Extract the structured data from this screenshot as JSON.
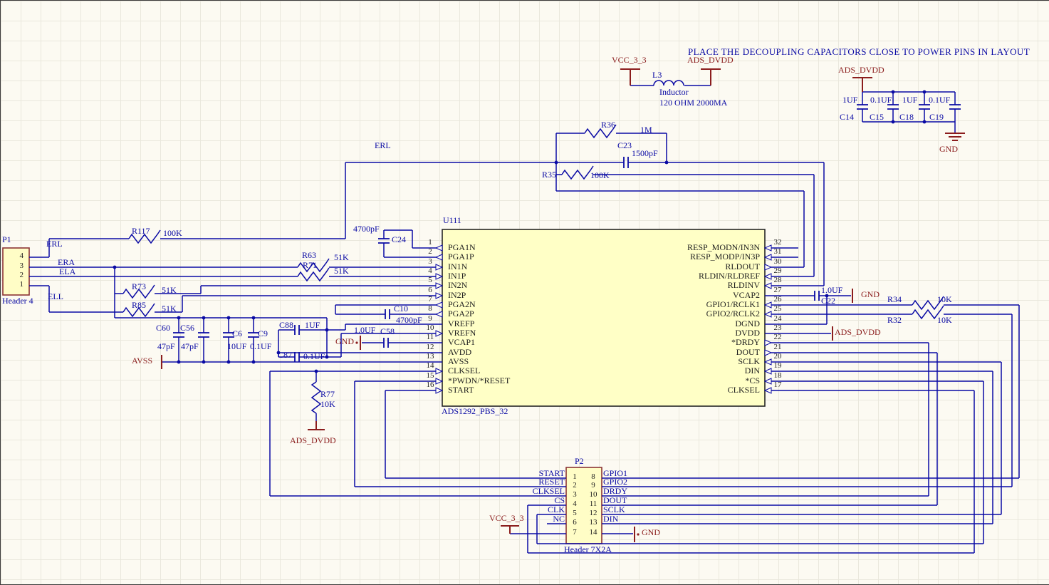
{
  "note": "PLACE THE DECOUPLING CAPACITORS CLOSE TO POWER PINS IN LAYOUT",
  "power": {
    "vcc": "VCC_3_3",
    "ads_dvdd": "ADS_DVDD",
    "gnd": "GND",
    "avss": "AVSS"
  },
  "nets": {
    "erl": "ERL",
    "era": "ERA",
    "ela": "ELA",
    "ell": "ELL"
  },
  "inductor": {
    "ref": "L3",
    "desc": "Inductor",
    "value": "120 OHM 2000MA"
  },
  "decoupling": {
    "caps": [
      {
        "ref": "C14",
        "value": "1UF"
      },
      {
        "ref": "C15",
        "value": "0.1UF"
      },
      {
        "ref": "C18",
        "value": "1UF"
      },
      {
        "ref": "C19",
        "value": "0.1UF"
      }
    ]
  },
  "rld": {
    "r36": {
      "ref": "R36",
      "value": "1M"
    },
    "c23": {
      "ref": "C23",
      "value": "1500pF"
    },
    "r35": {
      "ref": "R35",
      "value": "100K"
    }
  },
  "input_network": {
    "r117": {
      "ref": "R117",
      "value": "100K"
    },
    "r63": {
      "ref": "R63",
      "value": "51K"
    },
    "r71": {
      "ref": "R71",
      "value": "51K"
    },
    "r73": {
      "ref": "R73",
      "value": "51K"
    },
    "r85": {
      "ref": "R85",
      "value": "51K"
    },
    "c60": {
      "ref": "C60",
      "value": "47pF"
    },
    "c56": {
      "ref": "C56",
      "value": "47pF"
    },
    "c6": {
      "ref": "C6",
      "value": "10UF"
    },
    "c9": {
      "ref": "C9",
      "value": "0.1UF"
    },
    "c88": {
      "ref": "C88",
      "value": "1UF"
    },
    "c87": {
      "ref": "C87",
      "value": "0.1UF"
    },
    "c24": {
      "ref": "C24",
      "value": "4700pF"
    },
    "c10": {
      "ref": "C10",
      "value": "4700pF"
    },
    "c58": {
      "ref": "C58",
      "value": "1.0UF"
    }
  },
  "r77": {
    "ref": "R77",
    "value": "10K"
  },
  "right_side": {
    "c22": {
      "ref": "C22",
      "value": "1.0UF"
    },
    "r34": {
      "ref": "R34",
      "value": "10K"
    },
    "r32": {
      "ref": "R32",
      "value": "10K"
    }
  },
  "p1": {
    "ref": "P1",
    "type": "Header 4",
    "pins": [
      "4",
      "3",
      "2",
      "1"
    ]
  },
  "u111": {
    "ref": "U111",
    "part": "ADS1292_PBS_32",
    "left_pins": [
      {
        "num": "1",
        "name": "PGA1N"
      },
      {
        "num": "2",
        "name": "PGA1P"
      },
      {
        "num": "3",
        "name": "IN1N"
      },
      {
        "num": "4",
        "name": "IN1P"
      },
      {
        "num": "5",
        "name": "IN2N"
      },
      {
        "num": "6",
        "name": "IN2P"
      },
      {
        "num": "7",
        "name": "PGA2N"
      },
      {
        "num": "8",
        "name": "PGA2P"
      },
      {
        "num": "9",
        "name": "VREFP"
      },
      {
        "num": "10",
        "name": "VREFN"
      },
      {
        "num": "11",
        "name": "VCAP1"
      },
      {
        "num": "12",
        "name": "AVDD"
      },
      {
        "num": "13",
        "name": "AVSS"
      },
      {
        "num": "14",
        "name": "CLKSEL"
      },
      {
        "num": "15",
        "name": "*PWDN/*RESET"
      },
      {
        "num": "16",
        "name": "START"
      }
    ],
    "right_pins": [
      {
        "num": "32",
        "name": "RESP_MODN/IN3N"
      },
      {
        "num": "31",
        "name": "RESP_MODP/IN3P"
      },
      {
        "num": "30",
        "name": "RLDOUT"
      },
      {
        "num": "29",
        "name": "RLDIN/RLDREF"
      },
      {
        "num": "28",
        "name": "RLDINV"
      },
      {
        "num": "27",
        "name": "VCAP2"
      },
      {
        "num": "26",
        "name": "GPIO1/RCLK1"
      },
      {
        "num": "25",
        "name": "GPIO2/RCLK2"
      },
      {
        "num": "24",
        "name": "DGND"
      },
      {
        "num": "23",
        "name": "DVDD"
      },
      {
        "num": "22",
        "name": "*DRDY"
      },
      {
        "num": "21",
        "name": "DOUT"
      },
      {
        "num": "20",
        "name": "SCLK"
      },
      {
        "num": "19",
        "name": "DIN"
      },
      {
        "num": "18",
        "name": "*CS"
      },
      {
        "num": "17",
        "name": "CLKSEL"
      }
    ]
  },
  "p2": {
    "ref": "P2",
    "type": "Header 7X2A",
    "left_pins": [
      {
        "num": "1",
        "label": "START"
      },
      {
        "num": "2",
        "label": "RESET"
      },
      {
        "num": "3",
        "label": "CLKSEL"
      },
      {
        "num": "4",
        "label": "CS"
      },
      {
        "num": "5",
        "label": "CLK"
      },
      {
        "num": "6",
        "label": "NC"
      },
      {
        "num": "7",
        "label": ""
      }
    ],
    "right_pins": [
      {
        "num": "8",
        "label": "GPIO1"
      },
      {
        "num": "9",
        "label": "GPIO2"
      },
      {
        "num": "10",
        "label": "DRDY"
      },
      {
        "num": "11",
        "label": "DOUT"
      },
      {
        "num": "12",
        "label": "SCLK"
      },
      {
        "num": "13",
        "label": "DIN"
      },
      {
        "num": "14",
        "label": ""
      }
    ]
  }
}
